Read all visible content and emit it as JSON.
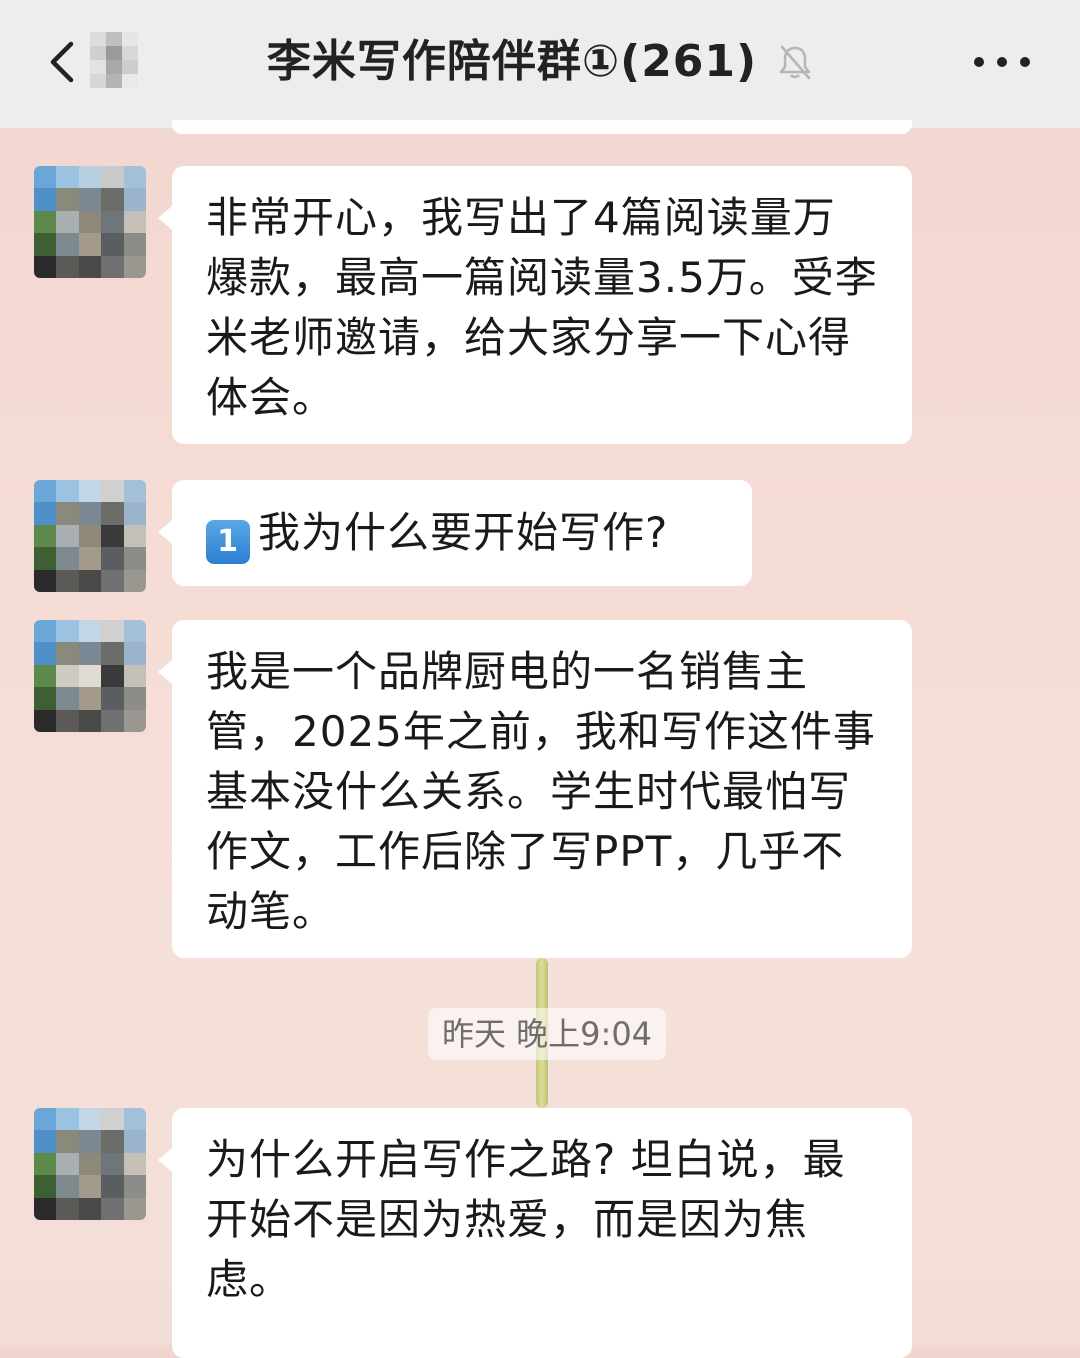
{
  "header": {
    "title": "李米写作陪伴群①(261)",
    "back_icon": "chevron-left-icon",
    "mute_icon": "bell-off-icon",
    "more_icon": "more-dots-icon"
  },
  "messages": [
    {
      "text": "非常开心，我写出了4篇阅读量万爆款，最高一篇阅读量3.5万。受李米老师邀请，给大家分享一下心得体会。"
    },
    {
      "badge": "1",
      "text": "我为什么要开始写作?"
    },
    {
      "text": "我是一个品牌厨电的一名销售主管，2025年之前，我和写作这件事基本没什么关系。学生时代最怕写作文，工作后除了写PPT，几乎不动笔。"
    },
    {
      "text": "为什么开启写作之路? 坦白说，最开始不是因为热爱，而是因为焦虑。"
    }
  ],
  "timestamp": "昨天 晚上9:04",
  "colors": {
    "header_bg": "#ededed",
    "bubble_bg": "#ffffff",
    "chat_bg": "#f4dcd5",
    "badge_blue": "#2c7fd0"
  }
}
